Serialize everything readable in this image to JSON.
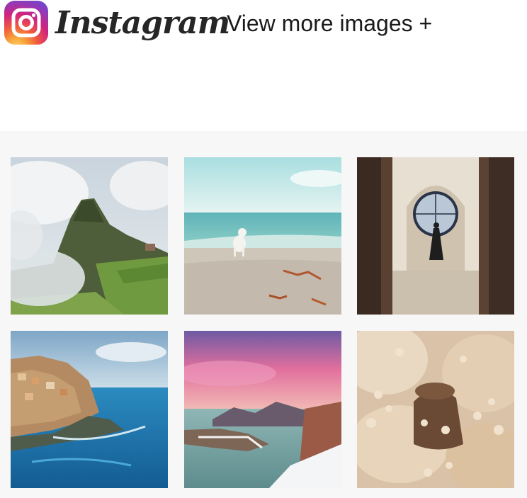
{
  "header": {
    "logo_icon": "instagram-icon",
    "wordmark": "Instagram",
    "view_more_label": "View more images +"
  },
  "gallery": {
    "images": [
      {
        "name": "mountain-ruins-photo"
      },
      {
        "name": "beach-dog-photo"
      },
      {
        "name": "doorway-clock-window-photo"
      },
      {
        "name": "cliff-village-sea-photo"
      },
      {
        "name": "pink-sky-coast-photo"
      },
      {
        "name": "dried-flowers-photo"
      }
    ]
  },
  "colors": {
    "gallery_background": "#f7f7f7",
    "text": "#1a1a1a"
  }
}
